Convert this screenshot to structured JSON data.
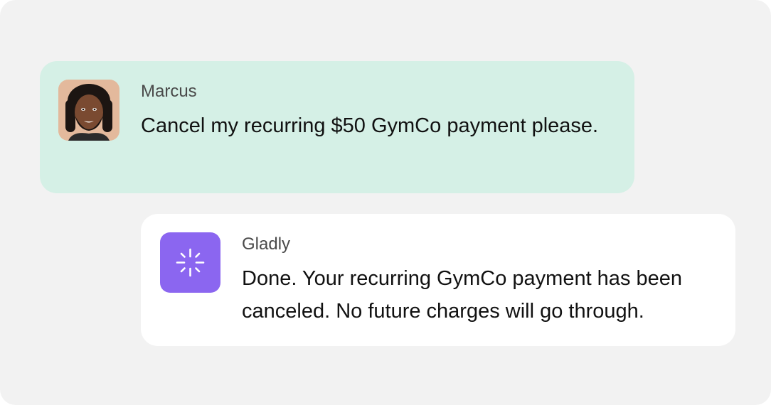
{
  "conversation": {
    "messages": [
      {
        "sender": "Marcus",
        "text": "Cancel my recurring $50 GymCo payment please.",
        "avatar_icon": "user-photo-avatar",
        "bubble_color": "#d5f0e6"
      },
      {
        "sender": "Gladly",
        "text": "Done. Your recurring GymCo payment has been canceled. No future charges will go through.",
        "avatar_icon": "gladly-sparkle-icon",
        "bubble_color": "#ffffff",
        "icon_color": "#8b66f0"
      }
    ]
  },
  "colors": {
    "background": "#f2f2f2",
    "sender_name": "#4a4a4a",
    "message_text": "#111111"
  }
}
